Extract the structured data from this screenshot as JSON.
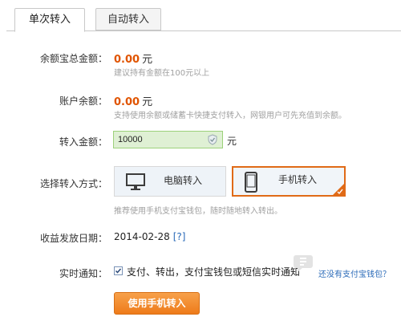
{
  "tabs": [
    {
      "label": "单次转入",
      "active": true
    },
    {
      "label": "自动转入",
      "active": false
    }
  ],
  "balance": {
    "label": "余额宝总金额：",
    "amount": "0.00",
    "unit": "元",
    "hint": "建议持有金额在100元以上"
  },
  "account": {
    "label": "账户余额：",
    "amount": "0.00",
    "unit": "元",
    "hint": "支持使用余额或储蓄卡快捷支付转入，网银用户可先充值到余额。"
  },
  "transfer": {
    "label": "转入金额：",
    "value": "10000",
    "unit": "元"
  },
  "method": {
    "label": "选择转入方式：",
    "options": [
      {
        "label": "电脑转入",
        "icon": "monitor-icon",
        "selected": false
      },
      {
        "label": "手机转入",
        "icon": "phone-icon",
        "selected": true
      }
    ],
    "hint": "推荐使用手机支付宝钱包，随时随地转入转出。"
  },
  "income_date": {
    "label": "收益发放日期：",
    "value": "2014-02-28",
    "help": "[?]"
  },
  "notify": {
    "label": "实时通知：",
    "checked": true,
    "text": "支付、转出，支付宝钱包或短信实时通知",
    "link": "还没有支付宝钱包？"
  },
  "submit": {
    "label": "使用手机转入"
  },
  "colors": {
    "accent": "#e05400",
    "button": "#ef8020",
    "selected_border": "#e06a17",
    "link": "#2a6ab8",
    "input_bg": "#dff0d4"
  }
}
